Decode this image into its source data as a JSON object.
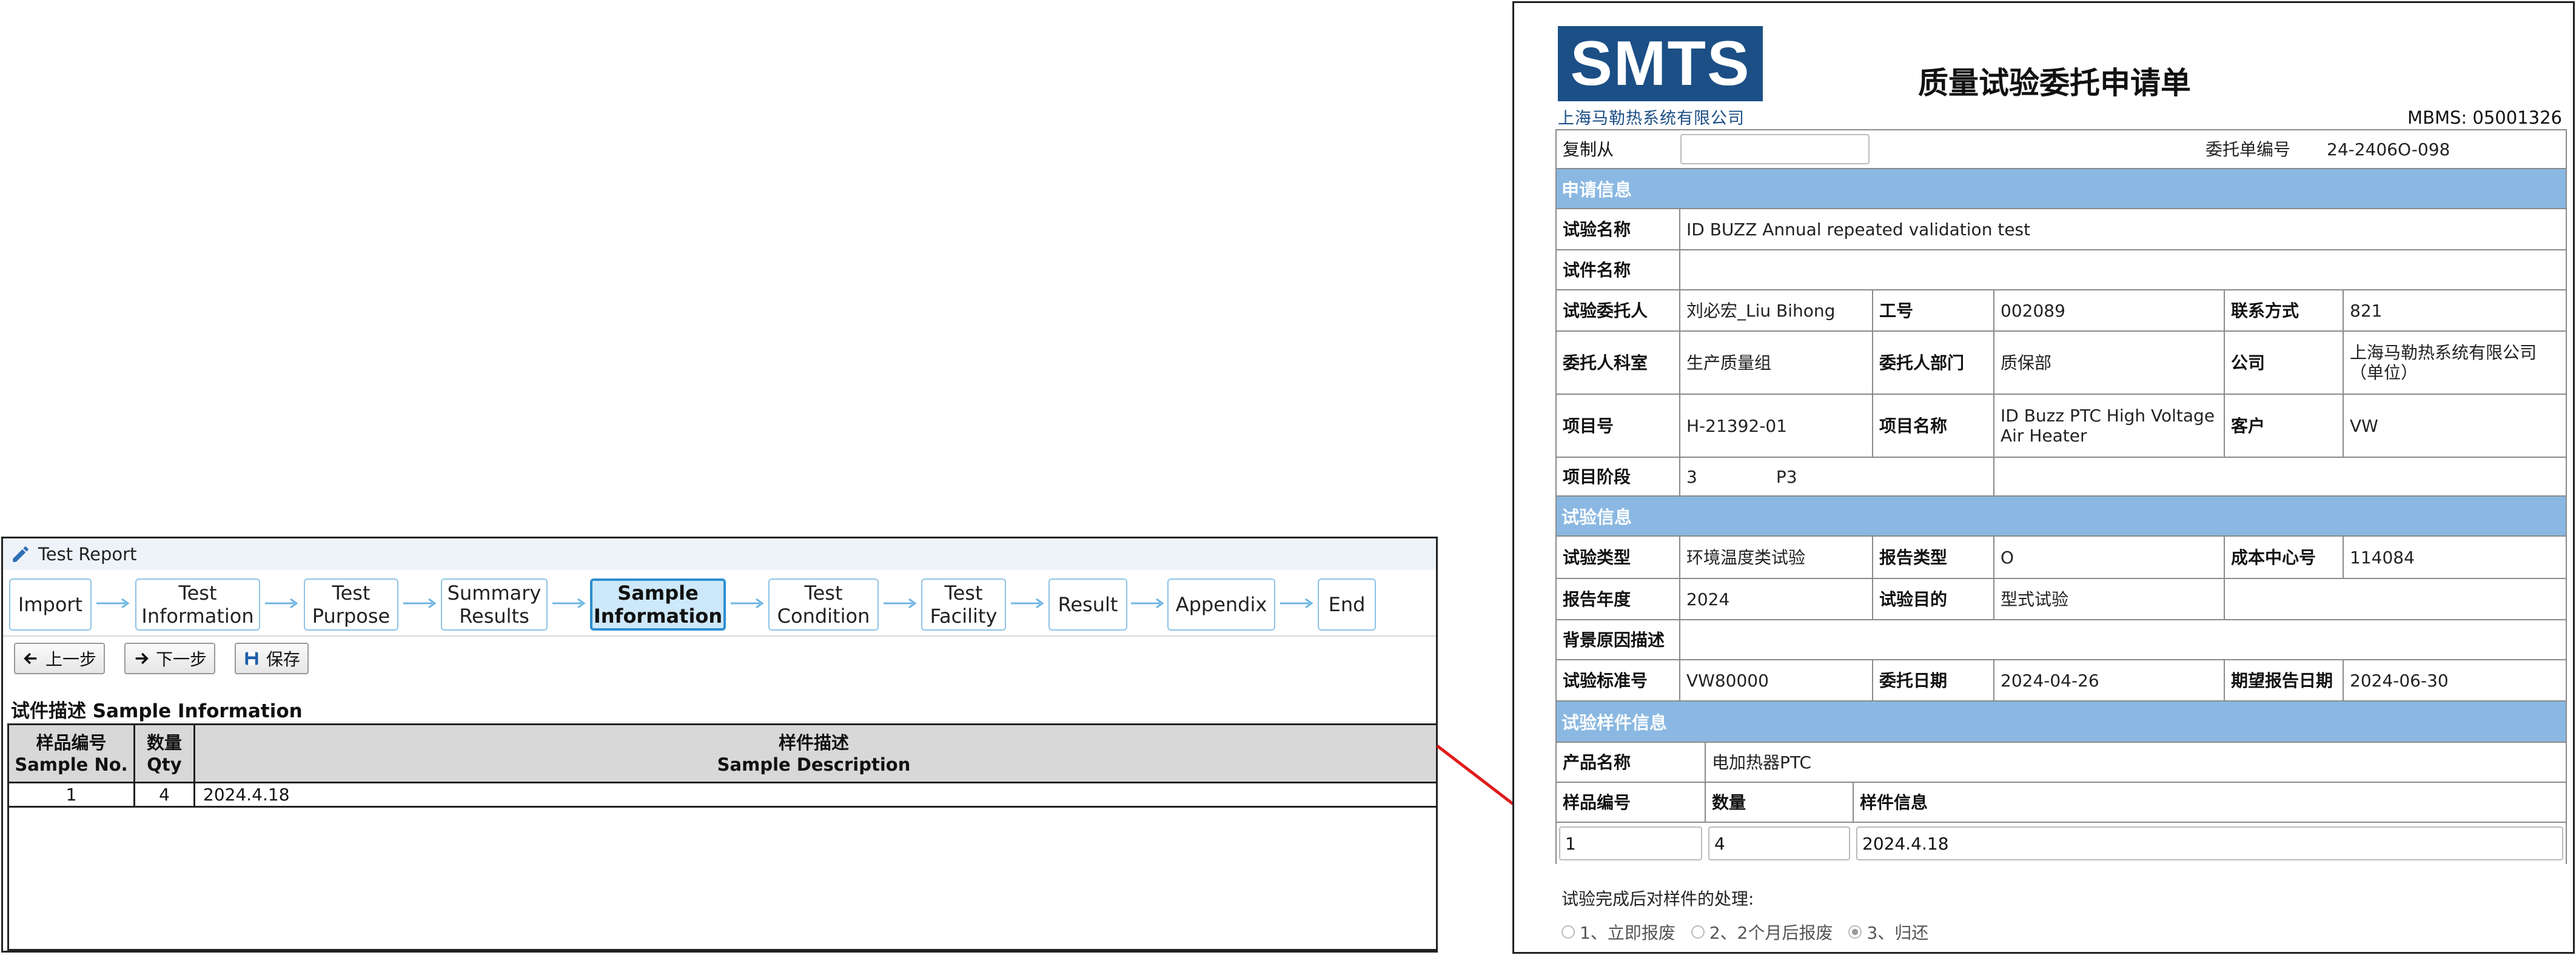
{
  "test_report": {
    "title": "Test Report",
    "steps": [
      {
        "label": "Import"
      },
      {
        "label": "Test Information"
      },
      {
        "label": "Test Purpose"
      },
      {
        "label": "Summary Results"
      },
      {
        "label": "Sample Information",
        "active": true
      },
      {
        "label": "Test Condition"
      },
      {
        "label": "Test Facility"
      },
      {
        "label": "Result"
      },
      {
        "label": "Appendix"
      },
      {
        "label": "End"
      }
    ],
    "buttons": {
      "prev": "上一步",
      "next": "下一步",
      "save": "保存"
    },
    "section_title": "试件描述 Sample Information",
    "table": {
      "headers": {
        "sample_no_cn": "样品编号",
        "sample_no_en": "Sample No.",
        "qty_cn": "数量",
        "qty_en": "Qty",
        "desc_cn": "样件描述",
        "desc_en": "Sample Description"
      },
      "rows": [
        {
          "sample_no": "1",
          "qty": "4",
          "description": "2024.4.18"
        }
      ]
    }
  },
  "form": {
    "logo": "SMTS",
    "company_name": "上海马勒热系统有限公司",
    "title": "质量试验委托申请单",
    "mbms": "MBMS: 05001326",
    "copy_from_label": "复制从",
    "copy_from_value": "",
    "order_no_label": "委托单编号",
    "order_no": "24-2406O-098",
    "sections": {
      "application": "申请信息",
      "test": "试验信息",
      "sample": "试验样件信息"
    },
    "test_name_label": "试验名称",
    "test_name": "ID BUZZ Annual repeated validation test",
    "part_name_label": "试件名称",
    "part_name": "",
    "requester_label": "试验委托人",
    "requester": "刘必宏_Liu Bihong",
    "emp_no_label": "工号",
    "emp_no": "002089",
    "contact_label": "联系方式",
    "contact": "821",
    "office_label": "委托人科室",
    "office": "生产质量组",
    "dept_label": "委托人部门",
    "dept": "质保部",
    "company_label": "公司",
    "company": "上海马勒热系统有限公司（单位）",
    "project_no_label": "项目号",
    "project_no": "H-21392-01",
    "project_name_label": "项目名称",
    "project_name": "ID Buzz PTC High Voltage Air Heater",
    "customer_label": "客户",
    "customer": "VW",
    "phase_label": "项目阶段",
    "phase_num": "3",
    "phase_code": "P3",
    "test_type_label": "试验类型",
    "test_type": "环境温度类试验",
    "report_type_label": "报告类型",
    "report_type": "O",
    "cost_center_label": "成本中心号",
    "cost_center": "114084",
    "report_year_label": "报告年度",
    "report_year": "2024",
    "purpose_label": "试验目的",
    "purpose": "型式试验",
    "background_label": "背景原因描述",
    "background": "",
    "standard_label": "试验标准号",
    "standard": "VW80000",
    "order_date_label": "委托日期",
    "order_date": "2024-04-26",
    "expected_date_label": "期望报告日期",
    "expected_date": "2024-06-30",
    "product_label": "产品名称",
    "product": "电加热器PTC",
    "sample_no_label": "样品编号",
    "qty_label": "数量",
    "sample_info_label": "样件信息",
    "sample_no": "1",
    "qty": "4",
    "sample_info": "2024.4.18",
    "disposal_label": "试验完成后对样件的处理:",
    "disposal_options": [
      "1、立即报废",
      "2、2个月后报废",
      "3、归还"
    ],
    "disposal_selected": 3
  },
  "colors": {
    "section_header": "#8ab8e2",
    "active_step": "#cde8fa",
    "logo_bg": "#1c4f86",
    "arrow": "#e01b1b"
  }
}
